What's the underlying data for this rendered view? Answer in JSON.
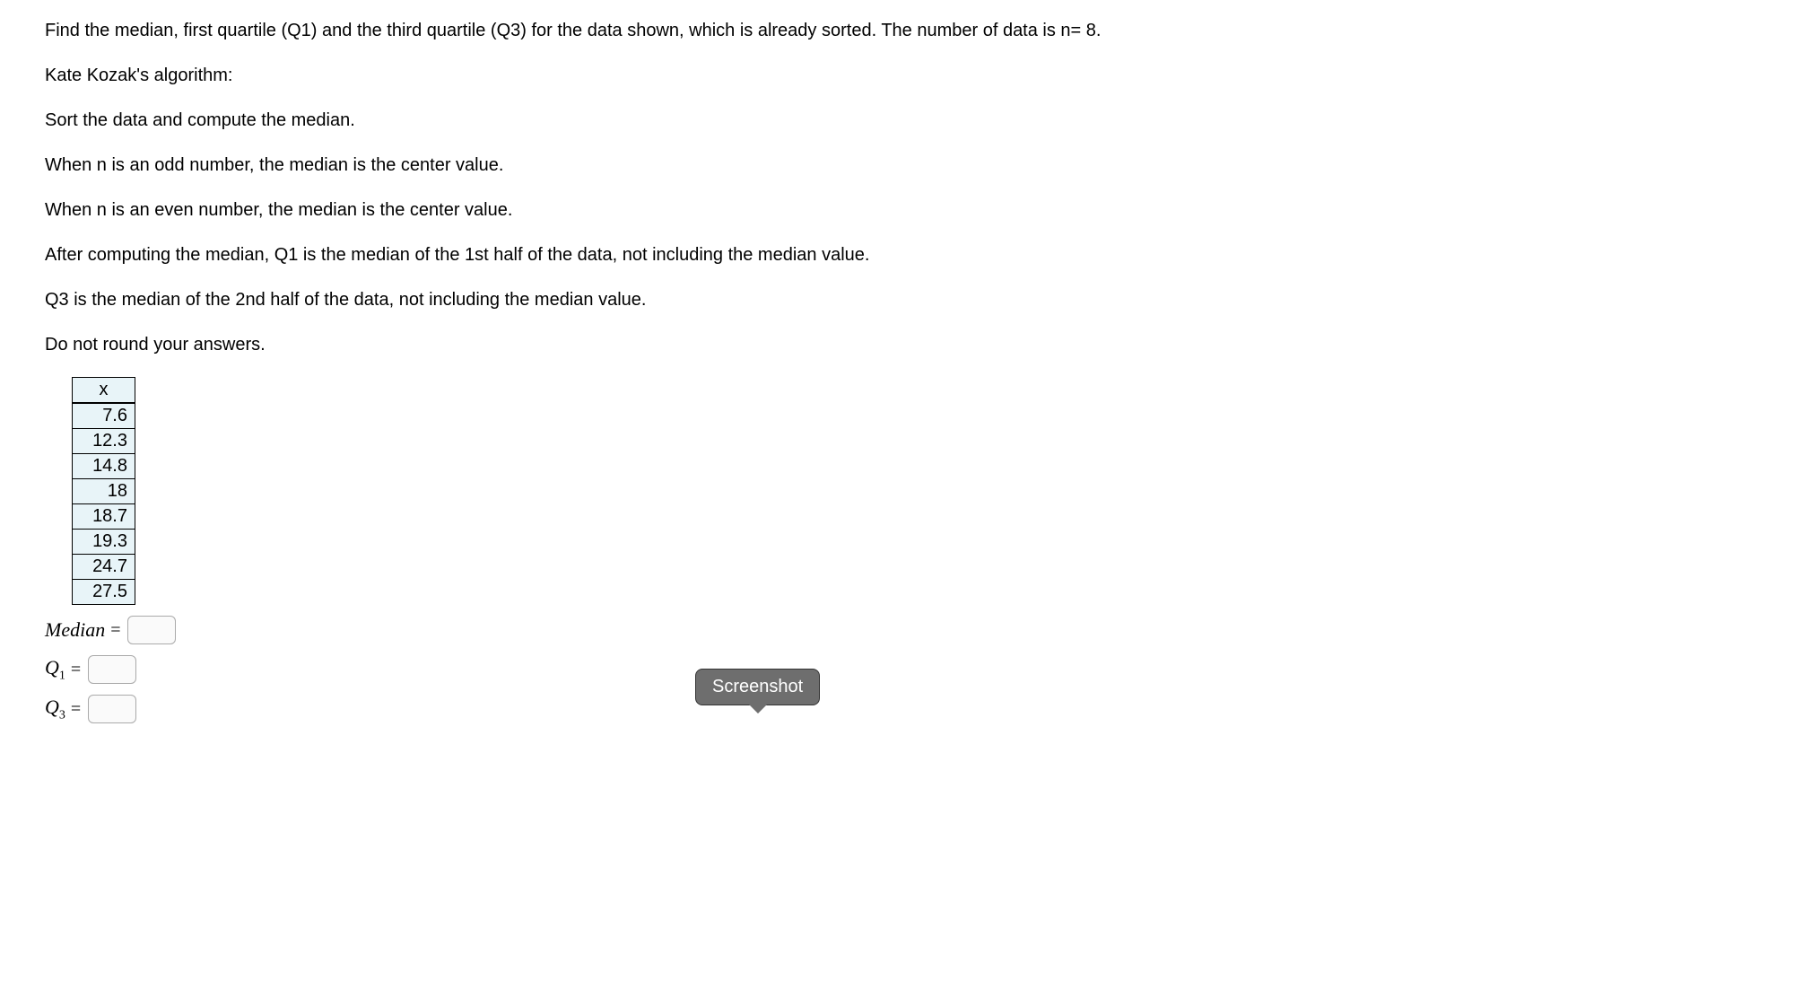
{
  "intro": {
    "line1": "Find the median, first quartile (Q1) and the third quartile (Q3) for the data shown, which is already sorted. The number of data is n= 8.",
    "line2": "Kate Kozak's algorithm:",
    "line3": "Sort the data and compute the median.",
    "line4": "When n is an odd number, the median is the center value.",
    "line5": "When n is an even number, the median is the center value.",
    "line6": "After computing the median, Q1 is the median of the 1st half of the data, not including the median value.",
    "line7": "Q3 is the median of the 2nd half of the data, not including the median value.",
    "line8": "Do not round your answers."
  },
  "table": {
    "header": "x",
    "rows": [
      "7.6",
      "12.3",
      "14.8",
      "18",
      "18.7",
      "19.3",
      "24.7",
      "27.5"
    ]
  },
  "answers": {
    "median_label": "Median",
    "q1_label": "Q",
    "q1_sub": "1",
    "q3_label": "Q",
    "q3_sub": "3",
    "equals": "="
  },
  "tooltip": {
    "text": "Screenshot"
  }
}
